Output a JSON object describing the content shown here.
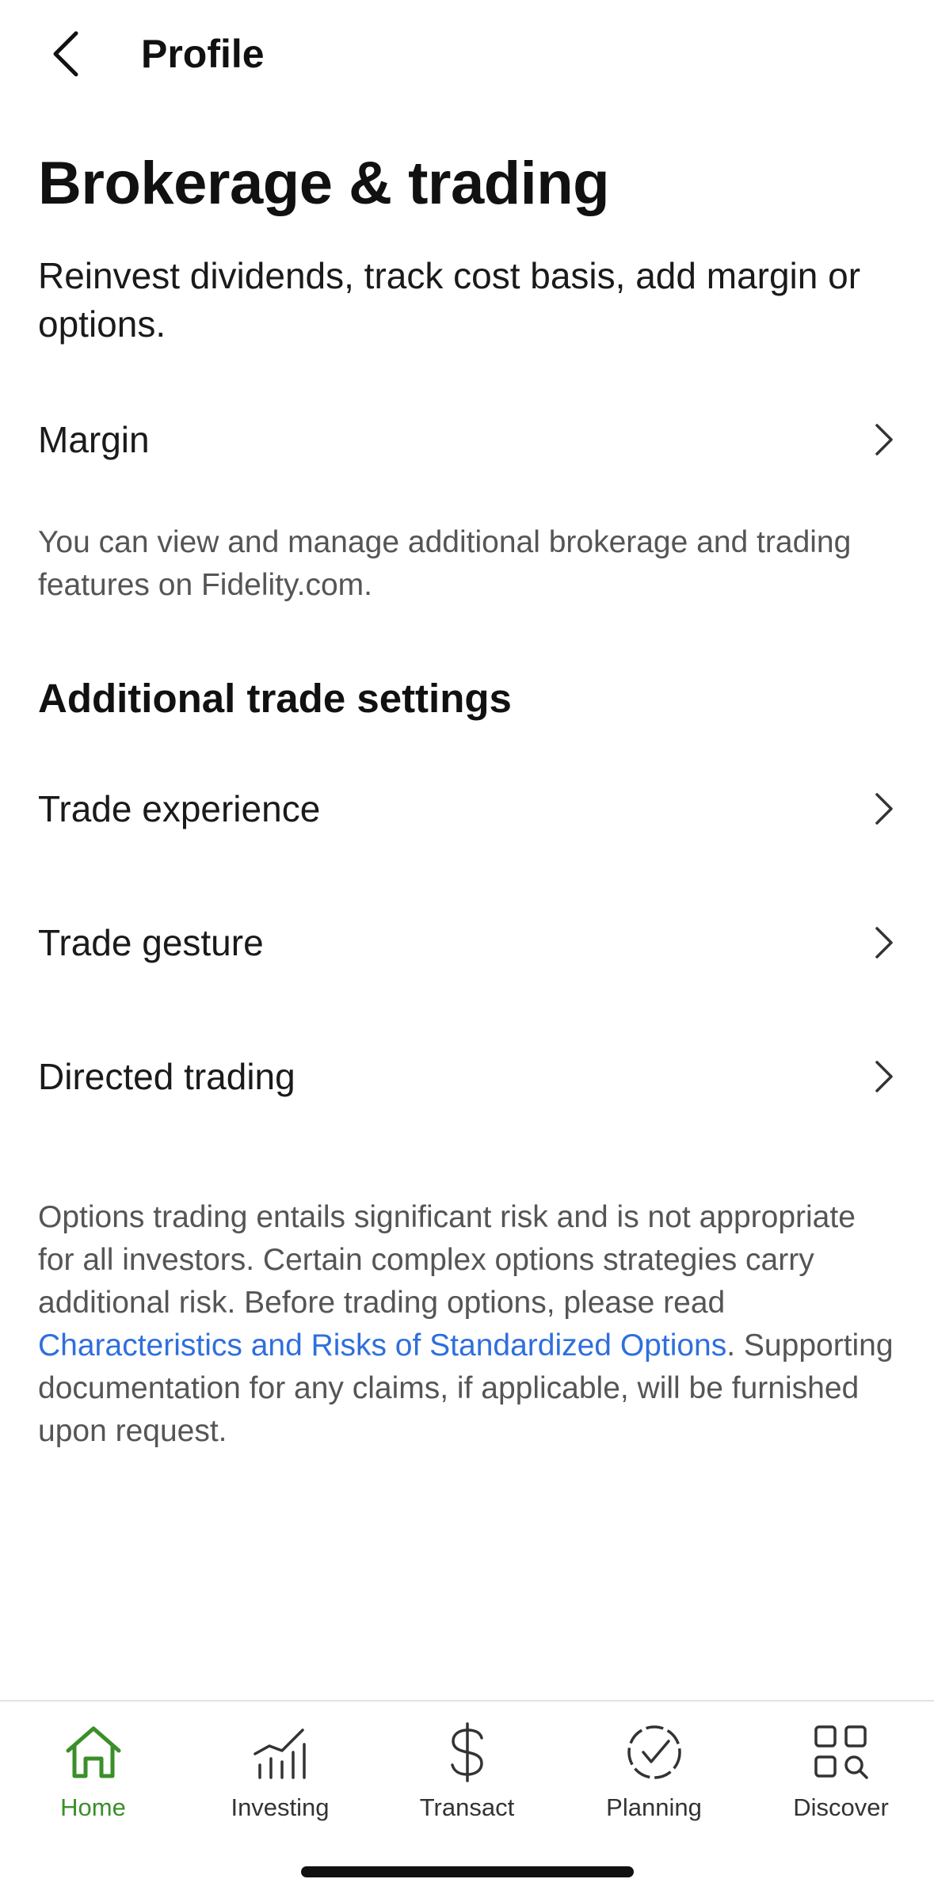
{
  "header": {
    "title": "Profile"
  },
  "page": {
    "title": "Brokerage & trading",
    "subtitle": "Reinvest dividends, track cost basis, add margin or options."
  },
  "rows_top": [
    {
      "label": "Margin"
    }
  ],
  "info_note": "You can view and manage additional brokerage and trading features on Fidelity.com.",
  "section": {
    "heading": "Additional trade settings",
    "rows": [
      {
        "label": "Trade experience"
      },
      {
        "label": "Trade gesture"
      },
      {
        "label": "Directed trading"
      }
    ]
  },
  "disclaimer": {
    "before_link": "Options trading entails significant risk and is not appropriate for all investors. Certain complex options strategies carry additional risk. Before trading options, please read ",
    "link_text": "Characteristics and Risks of Standardized Options",
    "after_link": ". Supporting documentation for any claims, if applicable, will be furnished upon request."
  },
  "tabbar": {
    "tabs": [
      {
        "label": "Home",
        "icon": "home-icon",
        "active": true
      },
      {
        "label": "Investing",
        "icon": "chart-icon",
        "active": false
      },
      {
        "label": "Transact",
        "icon": "dollar-icon",
        "active": false
      },
      {
        "label": "Planning",
        "icon": "planning-check-icon",
        "active": false
      },
      {
        "label": "Discover",
        "icon": "discover-grid-icon",
        "active": false
      }
    ]
  },
  "colors": {
    "active_tab": "#3b8f2a",
    "link": "#2f6fdc",
    "muted_text": "#555555"
  }
}
